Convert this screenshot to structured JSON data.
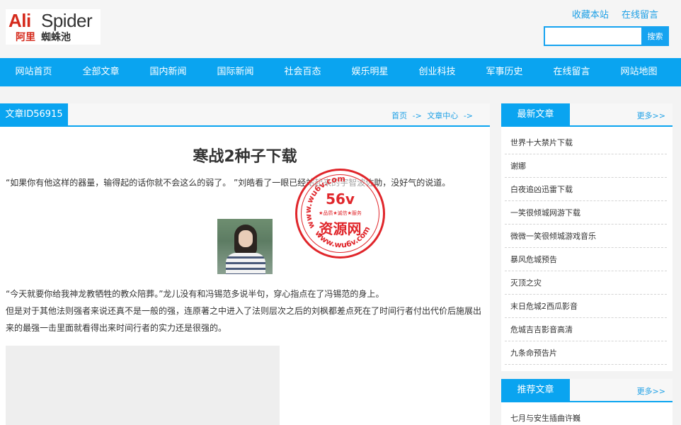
{
  "logo": {
    "brand_red": "Ali",
    "brand_dark": "Spider",
    "cn_red": "阿里",
    "cn_dark": "蜘蛛池"
  },
  "toplinks": [
    "收藏本站",
    "在线留言"
  ],
  "search": {
    "value": "",
    "button": "搜索"
  },
  "nav": [
    "网站首页",
    "全部文章",
    "国内新闻",
    "国际新闻",
    "社会百态",
    "娱乐明星",
    "创业科技",
    "军事历史",
    "在线留言",
    "网站地图"
  ],
  "article": {
    "id_label": "文章ID56915",
    "breadcrumb": [
      "首页",
      "->",
      "文章中心",
      "->"
    ],
    "title": "寒战2种子下载",
    "p1": "“如果你有他这样的器量，输得起的话你就不会这么的弱了。 ”刘皓看了一眼已经站起来的宇智波佐助，没好气的说道。",
    "p2": "“今天就要你给我神龙教牺牲的教众陪葬。”龙儿没有和冯锡范多说半句，穿心指点在了冯锡范的身上。",
    "p3": "但是对于其他法则强者来说还真不是一般的强，连原著之中进入了法则层次之后的刘枫都差点死在了时间行者付出代价后施展出来的最强一击里面就看得出来时间行者的实力还是很强的。"
  },
  "watermark": {
    "url_top": "www.wu6v.com",
    "big": "56v",
    "slogan": "★品质★诚信★服务",
    "name": "资源网",
    "url_bottom": "www.wu6v.com"
  },
  "sidebar_new": {
    "title": "最新文章",
    "more": "更多>>",
    "items": [
      "世界十大禁片下载",
      "谢娜",
      "白夜追凶迅雷下载",
      "一笑很倾城网游下载",
      "微微一笑很倾城游戏音乐",
      "暴风危城预告",
      "灭顶之灾",
      "末日危城2西瓜影音",
      "危城吉吉影音高清",
      "九条命预告片"
    ]
  },
  "sidebar_rec": {
    "title": "推荐文章",
    "more": "更多>>",
    "items": [
      "七月与安生插曲许巍"
    ]
  },
  "colors": {
    "accent": "#0aa4f0",
    "link": "#1ea0e6",
    "brand_red": "#d52a1c",
    "stamp_red": "#e0262b"
  }
}
